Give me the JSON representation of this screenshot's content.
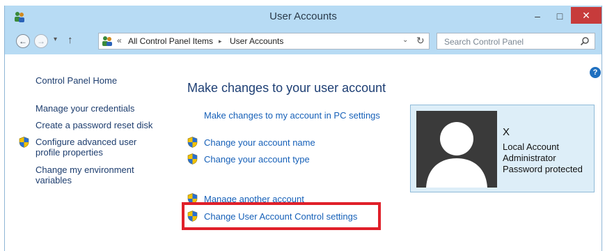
{
  "window": {
    "title": "User Accounts",
    "minimize_glyph": "–",
    "maximize_glyph": "□",
    "close_glyph": "✕"
  },
  "nav": {
    "back_glyph": "←",
    "forward_glyph": "→",
    "recent_glyph": "▾",
    "up_glyph": "↑",
    "breadcrumb_prefix": "«",
    "breadcrumb": [
      "All Control Panel Items",
      "User Accounts"
    ],
    "separator": "▸",
    "dropdown_glyph": "⌄",
    "refresh_glyph": "↻",
    "search_placeholder": "Search Control Panel"
  },
  "help_glyph": "?",
  "sidebar": {
    "home": "Control Panel Home",
    "items": [
      "Manage your credentials",
      "Create a password reset disk",
      "Configure advanced user profile properties",
      "Change my environment variables"
    ],
    "items_wrapped": {
      "advanced_line1": "Configure advanced user",
      "advanced_line2": "profile properties",
      "env_line1": "Change my environment",
      "env_line2": "variables"
    }
  },
  "main": {
    "title": "Make changes to your user account",
    "pc_settings_link": "Make changes to my account in PC settings",
    "change_name": "Change your account name",
    "change_type": "Change your account type",
    "manage_another": "Manage another account",
    "uac_settings": "Change User Account Control settings"
  },
  "account": {
    "name": "X",
    "details": [
      "Local Account",
      "Administrator",
      "Password protected"
    ]
  },
  "colors": {
    "link": "#1660b8",
    "highlight": "#e0202a",
    "titlebar": "#b7dbf4",
    "close": "#c73b3b"
  },
  "icons": {
    "title": "user-accounts-icon",
    "shield": "uac-shield-icon",
    "search": "search-icon",
    "help": "help-icon"
  }
}
